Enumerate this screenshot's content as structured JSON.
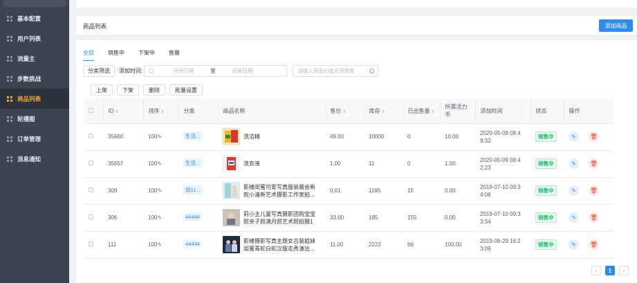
{
  "sidebar": {
    "items": [
      {
        "label": "基本配置"
      },
      {
        "label": "用户列表"
      },
      {
        "label": "流量主"
      },
      {
        "label": "步数挑战"
      },
      {
        "label": "商品列表"
      },
      {
        "label": "轮播图"
      },
      {
        "label": "订单管理"
      },
      {
        "label": "消息通知"
      }
    ],
    "active_index": 4
  },
  "header": {
    "title": "商品列表",
    "add_button": "添加商品"
  },
  "tabs": [
    {
      "label": "全部",
      "active": true
    },
    {
      "label": "销售中"
    },
    {
      "label": "下架中"
    },
    {
      "label": "售罄"
    }
  ],
  "filter": {
    "category_button": "分类筛选",
    "time_label": "添加时间:",
    "start_placeholder": "开始日期",
    "range_sep": "至",
    "end_placeholder": "结束日期",
    "search_placeholder": "请输入商品ID或名称搜索"
  },
  "actions": {
    "up": "上架",
    "down": "下架",
    "delete": "删除",
    "batch": "批量设置"
  },
  "table": {
    "headers": {
      "id": "ID",
      "sort": "排序",
      "category": "分类",
      "name": "商品名称",
      "price": "售价",
      "stock": "库存",
      "sold": "已出售量",
      "coin_1": "所需活力",
      "coin_2": "币",
      "time": "添加时间",
      "status": "状态",
      "ops": "操作"
    },
    "rows": [
      {
        "id": "35660",
        "sort": "100",
        "category": "生活...",
        "name": "洗洁精",
        "price": "49.00",
        "stock": "10000",
        "sold": "0",
        "coin": "10.00",
        "time_1": "2020-05-09 08:4",
        "time_2": "9:32",
        "status": "销售中"
      },
      {
        "id": "35657",
        "sort": "100",
        "category": "生活...",
        "name": "洗衣液",
        "price": "1.00",
        "stock": "11",
        "sold": "0",
        "coin": "1.00",
        "time_1": "2020-05-09 08:4",
        "time_2": "2:23",
        "status": "销售中"
      },
      {
        "id": "309",
        "sort": "100",
        "category": "双11...",
        "name_1": "影楼闺蜜可爱写真服装展会新",
        "name_2": "款小清新艺术摄影工作室拍...",
        "price": "0.01",
        "stock": "1195",
        "sold": "15",
        "coin": "0.00",
        "time_1": "2019-07-10 09:3",
        "time_2": "4:08",
        "status": "销售中"
      },
      {
        "id": "306",
        "sort": "100",
        "category": "44444",
        "name_1": "莉小主儿童写真摄影团购宝宝",
        "name_2": "照亲子照满月照艺术照拍摄1",
        "price": "33.00",
        "stock": "185",
        "sold": "155",
        "coin": "0.00",
        "time_1": "2019-07-10 09:3",
        "time_2": "3:34",
        "status": "销售中"
      },
      {
        "id": "111",
        "sort": "100",
        "category": "44444",
        "name_1": "影楼摄影写真主题女古装姐妹",
        "name_2": "闺蜜青蛇白蛇汉服走秀演出...",
        "price": "11.00",
        "stock": "2222",
        "sold": "66",
        "coin": "100.00",
        "time_1": "2019-06-29 16:2",
        "time_2": "3:09",
        "status": "销售中"
      }
    ]
  },
  "pager": {
    "prev": "‹",
    "current": "1",
    "next": "›"
  }
}
